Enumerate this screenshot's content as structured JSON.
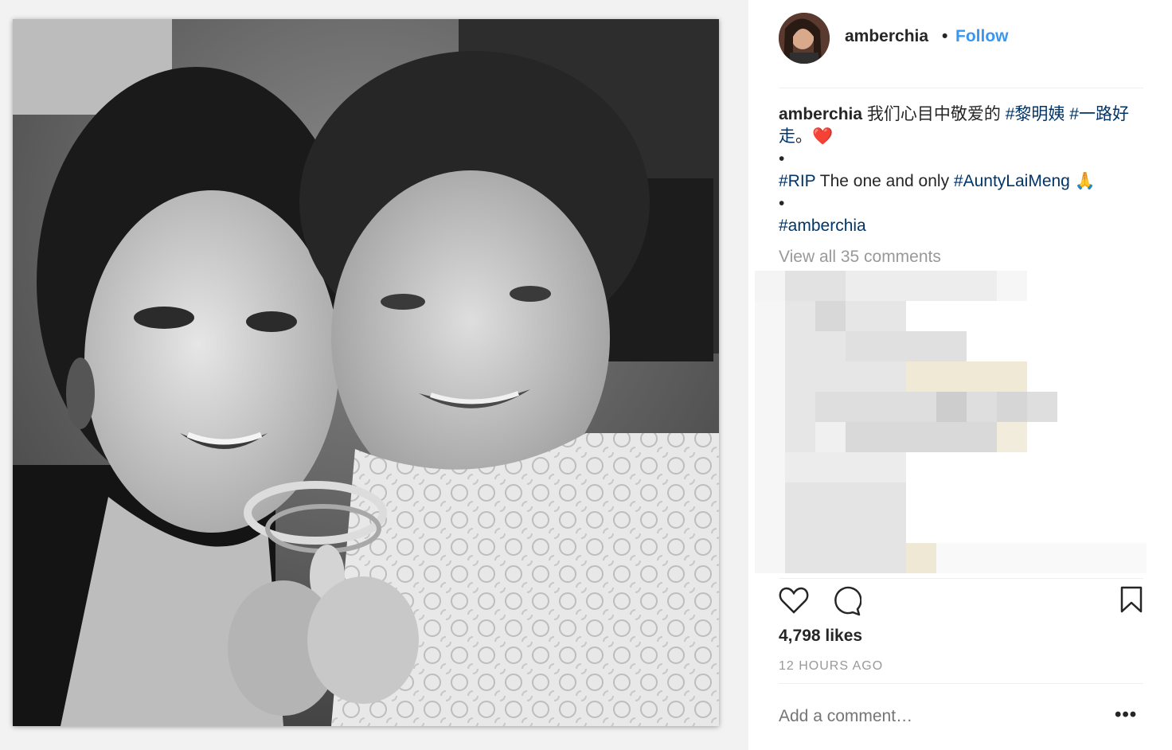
{
  "post": {
    "image_alt": "Black and white selfie of two women holding a trophy"
  },
  "header": {
    "username": "amberchia",
    "separator": "•",
    "follow_label": "Follow"
  },
  "caption": {
    "username": "amberchia",
    "text_cn": "我们心目中敬爱的",
    "tag1": "#黎明姨",
    "tag2": "#一路好走",
    "period": "。",
    "heart": "❤️",
    "bullet1": "•",
    "tag_rip": "#RIP",
    "text_en": "The one and only",
    "tag_aunty": "#AuntyLaiMeng",
    "pray": "🙏",
    "bullet2": "•",
    "tag_amber": "#amberchia"
  },
  "comments": {
    "view_all": "View all 35 comments"
  },
  "actions": {
    "like_icon": "heart-outline-icon",
    "comment_icon": "comment-bubble-icon",
    "save_icon": "bookmark-icon"
  },
  "stats": {
    "likes": "4,798 likes",
    "time": "12 HOURS AGO"
  },
  "composer": {
    "placeholder": "Add a comment…",
    "more": "•••"
  },
  "colors": {
    "link": "#3897f0",
    "hashtag": "#003569",
    "muted": "#999999"
  }
}
